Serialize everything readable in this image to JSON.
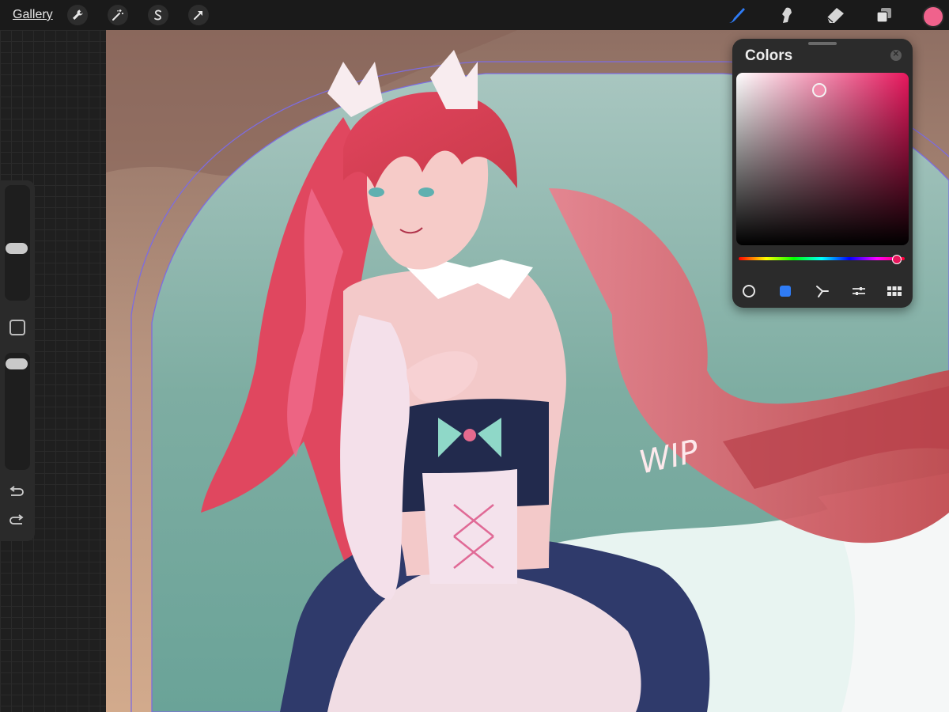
{
  "app": {
    "gallery_label": "Gallery"
  },
  "toolbar": {
    "left_icons": [
      "wrench-icon",
      "magic-wand-icon",
      "selection-icon",
      "transform-arrow-icon"
    ],
    "right_icons": [
      "brush-icon",
      "smudge-icon",
      "eraser-icon",
      "layers-icon"
    ],
    "active_tool": "brush",
    "accent_color": "#2f7cf6",
    "current_color": "#f0628c"
  },
  "sidebar": {
    "brush_size_level": 0.45,
    "opacity_level": 0.95,
    "icons": [
      "modify-square-icon",
      "undo-icon",
      "redo-icon"
    ]
  },
  "colors_panel": {
    "title": "Colors",
    "hue_color": "#e8175d",
    "selected_color": "#f08fae",
    "modes": [
      "disc-icon",
      "classic-icon",
      "harmony-icon",
      "value-icon",
      "palettes-icon"
    ],
    "active_mode": "classic"
  },
  "canvas": {
    "annotation": "WIP"
  }
}
